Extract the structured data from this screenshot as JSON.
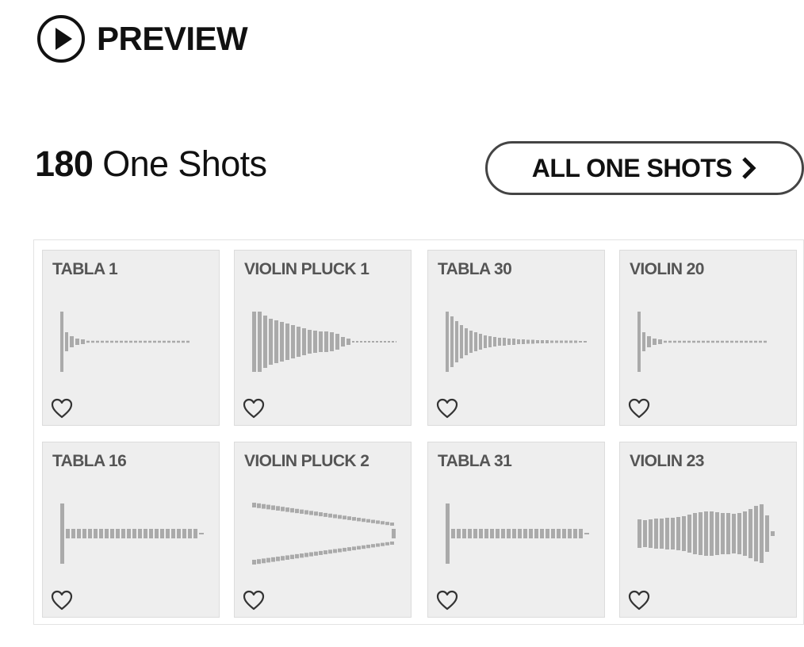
{
  "header": {
    "title": "PREVIEW",
    "icon": "play-circle-icon"
  },
  "summary": {
    "count": "180",
    "label": "One Shots"
  },
  "all_button": {
    "label": "ALL ONE SHOTS",
    "icon": "chevron-right-icon"
  },
  "colors": {
    "card_bg": "#eeeeee",
    "waveform": "#aaaaaa",
    "title": "#555555",
    "text": "#111111"
  },
  "samples": [
    {
      "title": "TABLA 1",
      "favorite_icon": "heart-outline-icon",
      "waveform_shape": "sharp-decay-long-tail"
    },
    {
      "title": "VIOLIN PLUCK 1",
      "favorite_icon": "heart-outline-icon",
      "waveform_shape": "gradual-decay"
    },
    {
      "title": "TABLA 30",
      "favorite_icon": "heart-outline-icon",
      "waveform_shape": "decay"
    },
    {
      "title": "VIOLIN 20",
      "favorite_icon": "heart-outline-icon",
      "waveform_shape": "sharp-decay-long-tail"
    },
    {
      "title": "TABLA 16",
      "favorite_icon": "heart-outline-icon",
      "waveform_shape": "spike-then-flat"
    },
    {
      "title": "VIOLIN PLUCK 2",
      "favorite_icon": "heart-outline-icon",
      "waveform_shape": "narrowing-split"
    },
    {
      "title": "TABLA 31",
      "favorite_icon": "heart-outline-icon",
      "waveform_shape": "spike-then-flat"
    },
    {
      "title": "VIOLIN 23",
      "favorite_icon": "heart-outline-icon",
      "waveform_shape": "sustained-swell"
    }
  ]
}
